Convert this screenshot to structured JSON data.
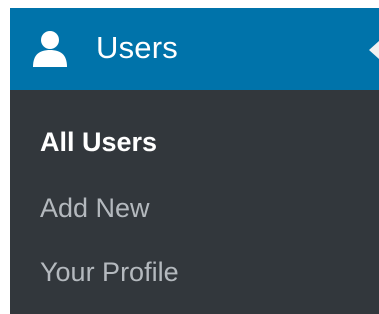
{
  "menu": {
    "icon": "user-icon",
    "label": "Users",
    "colors": {
      "active_background": "#0073aa",
      "submenu_background": "#32373c",
      "current_text": "#ffffff",
      "text": "#b4b9be"
    },
    "submenu": [
      {
        "label": "All Users",
        "current": true
      },
      {
        "label": "Add New",
        "current": false
      },
      {
        "label": "Your Profile",
        "current": false
      }
    ]
  }
}
